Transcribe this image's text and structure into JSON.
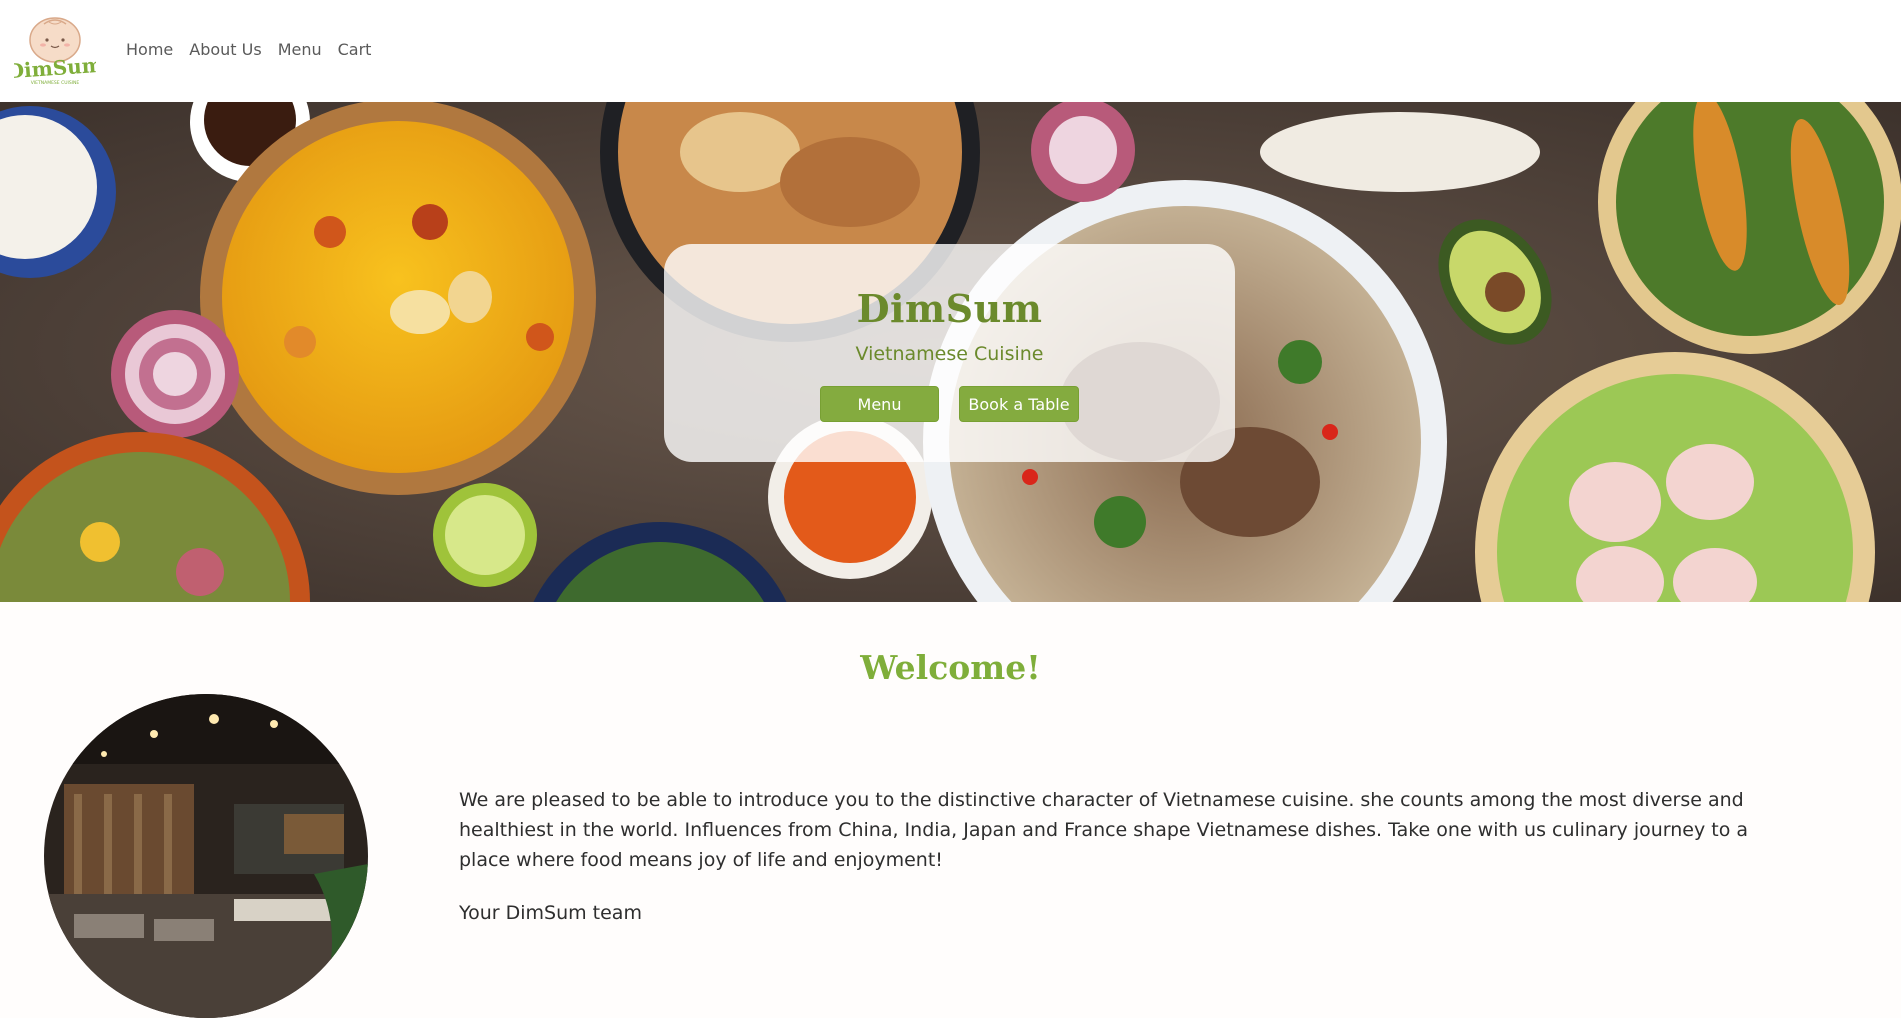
{
  "brand": {
    "logo_text": "DimSum",
    "logo_tagline": "VIETNAMESE CUISINE"
  },
  "nav": {
    "items": [
      {
        "label": "Home"
      },
      {
        "label": "About Us"
      },
      {
        "label": "Menu"
      },
      {
        "label": "Cart"
      }
    ]
  },
  "hero": {
    "title": "DimSum",
    "subtitle": "Vietnamese Cuisine",
    "menu_button": "Menu",
    "book_button": "Book a Table"
  },
  "welcome": {
    "heading": "Welcome!",
    "paragraph": "We are pleased to be able to introduce you to the distinctive character of Vietnamese cuisine. she counts among the most diverse and healthiest in the world. Influences from China, India, Japan and France shape Vietnamese dishes. Take one with us culinary journey to a place where food means joy of life and enjoyment!",
    "signature": "Your DimSum team"
  },
  "colors": {
    "brand_green": "#84ab3f",
    "title_green": "#6b8a2c",
    "heading_green": "#7fae3a"
  }
}
